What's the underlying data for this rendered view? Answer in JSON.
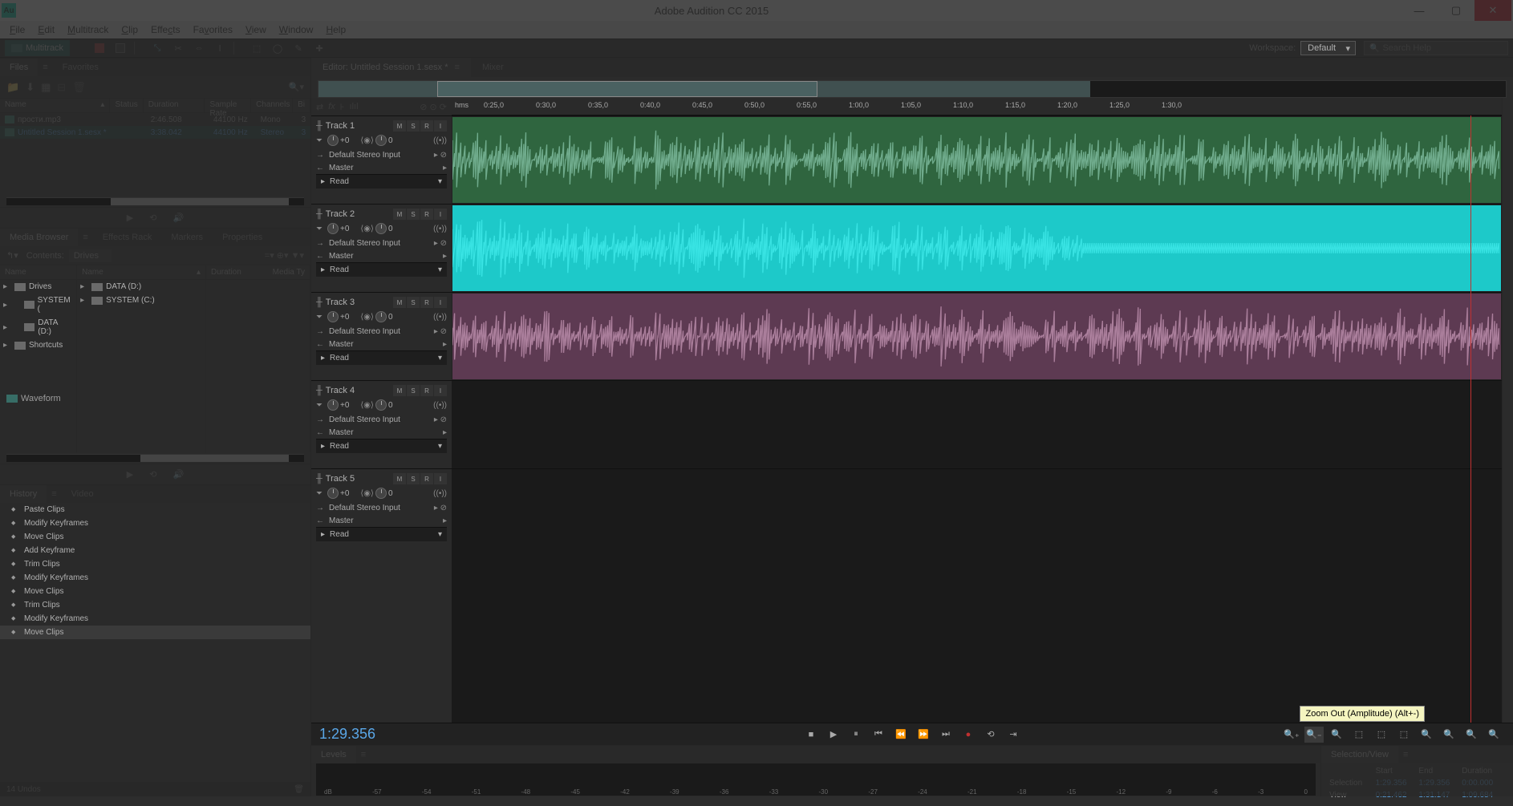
{
  "app": {
    "title": "Adobe Audition CC 2015",
    "logo": "Au"
  },
  "menus": [
    "File",
    "Edit",
    "Multitrack",
    "Clip",
    "Effects",
    "Favorites",
    "View",
    "Window",
    "Help"
  ],
  "toolbar": {
    "wave": "Waveform",
    "multi": "Multitrack",
    "workspace_lbl": "Workspace:",
    "workspace_val": "Default",
    "search_ph": "Search Help"
  },
  "files_panel": {
    "tab1": "Files",
    "tab2": "Favorites",
    "cols": {
      "name": "Name",
      "status": "Status",
      "duration": "Duration",
      "sr": "Sample Rate",
      "ch": "Channels",
      "bit": "Bi"
    },
    "rows": [
      {
        "name": "прости.mp3",
        "dur": "2:46.508",
        "sr": "44100 Hz",
        "ch": "Mono",
        "bit": "3"
      },
      {
        "name": "Untitled Session 1.sesx *",
        "dur": "3:38.042",
        "sr": "44100 Hz",
        "ch": "Stereo",
        "bit": "3"
      }
    ]
  },
  "media_panel": {
    "tab1": "Media Browser",
    "tab2": "Effects Rack",
    "tab3": "Markers",
    "tab4": "Properties",
    "contents_lbl": "Contents:",
    "contents_val": "Drives",
    "left": {
      "hdr": "Name",
      "r1": "Drives",
      "r2": "SYSTEM (",
      "r3": "DATA (D:)",
      "r4": "Shortcuts"
    },
    "mid": {
      "hdr": "Name",
      "r1": "DATA (D:)",
      "r2": "SYSTEM (C:)"
    },
    "right": {
      "hdr1": "Duration",
      "hdr2": "Media Ty"
    }
  },
  "history_panel": {
    "tab1": "History",
    "tab2": "Video",
    "items": [
      "Paste Clips",
      "Modify Keyframes",
      "Move Clips",
      "Add Keyframe",
      "Trim Clips",
      "Modify Keyframes",
      "Move Clips",
      "Trim Clips",
      "Modify Keyframes",
      "Move Clips"
    ],
    "status": "14 Undos"
  },
  "editor": {
    "tab_editor": "Editor: Untitled Session 1.sesx *",
    "tab_mixer": "Mixer",
    "ruler_unit": "hms",
    "ticks": [
      "0:25,0",
      "0:30,0",
      "0:35,0",
      "0:40,0",
      "0:45,0",
      "0:50,0",
      "0:55,0",
      "1:00,0",
      "1:05,0",
      "1:10,0",
      "1:15,0",
      "1:20,0",
      "1:25,0",
      "1:30,0"
    ],
    "tracks": [
      {
        "name": "Track 1",
        "input": "Default Stereo Input",
        "output": "Master",
        "mode": "Read",
        "gain": "+0",
        "pan": "0",
        "color": "#2f653f",
        "wave": "#7bb89a"
      },
      {
        "name": "Track 2",
        "input": "Default Stereo Input",
        "output": "Master",
        "mode": "Read",
        "gain": "+0",
        "pan": "0",
        "color": "#1dc9c9",
        "wave": "#3de8e8"
      },
      {
        "name": "Track 3",
        "input": "Default Stereo Input",
        "output": "Master",
        "mode": "Read",
        "gain": "+0",
        "pan": "0",
        "color": "#5d3a52",
        "wave": "#b88aa8"
      },
      {
        "name": "Track 4",
        "input": "Default Stereo Input",
        "output": "Master",
        "mode": "Read",
        "gain": "+0",
        "pan": "0",
        "color": "#3a3a6a",
        "wave": "#8888b8"
      },
      {
        "name": "Track 5",
        "input": "Default Stereo Input",
        "output": "Master",
        "mode": "Read",
        "gain": "+0",
        "pan": "0",
        "color": "#3c6a3c",
        "wave": "#90b890"
      }
    ],
    "timecode": "1:29.356",
    "tooltip": "Zoom Out (Amplitude) (Alt+-)"
  },
  "levels_panel": {
    "tab": "Levels",
    "scale": [
      "dB",
      "-57",
      "-54",
      "-51",
      "-48",
      "-45",
      "-42",
      "-39",
      "-36",
      "-33",
      "-30",
      "-27",
      "-24",
      "-21",
      "-18",
      "-15",
      "-12",
      "-9",
      "-6",
      "-3",
      "0"
    ]
  },
  "selview": {
    "tab": "Selection/View",
    "hdrs": [
      "Start",
      "End",
      "Duration"
    ],
    "rows": [
      {
        "lbl": "Selection",
        "start": "1:29.356",
        "end": "1:29.356",
        "dur": "0:00.000"
      },
      {
        "lbl": "View",
        "start": "0:21.462",
        "end": "1:31.147",
        "dur": "1:09.684"
      }
    ]
  }
}
